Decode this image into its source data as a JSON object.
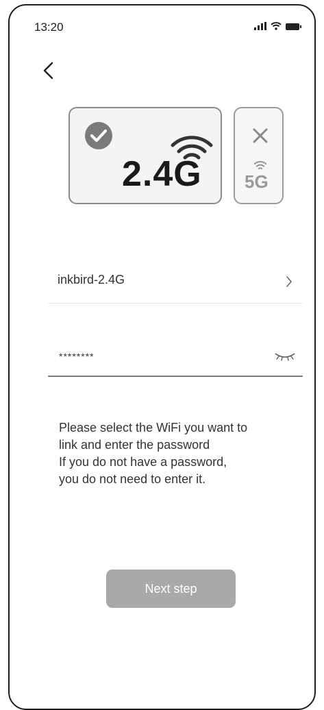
{
  "status_bar": {
    "time": "13:20",
    "icons": [
      "signal-icon",
      "wifi-icon",
      "battery-icon"
    ]
  },
  "header": {
    "back_icon": "chevron-left-icon"
  },
  "band_options": [
    {
      "label": "2.4G",
      "selected": true,
      "status_icon": "check-circle-icon",
      "band_icon": "wifi-icon"
    },
    {
      "label": "5G",
      "selected": false,
      "status_icon": "close-icon",
      "band_icon": "wifi-icon"
    }
  ],
  "wifi": {
    "ssid": "inkbird-2.4G",
    "chevron_icon": "chevron-right-icon"
  },
  "password": {
    "value": "********",
    "toggle_icon": "eye-closed-icon"
  },
  "instructions": [
    "Please select the WiFi you want to",
    "link and enter the password",
    "If you do not have a password,",
    "you do not need to enter it."
  ],
  "actions": {
    "next_label": "Next step"
  },
  "colors": {
    "button_bg": "#a9a9a9",
    "card_border": "#8a8a8a",
    "check": "#7a7a7a",
    "disabled": "#9a9a9a"
  }
}
